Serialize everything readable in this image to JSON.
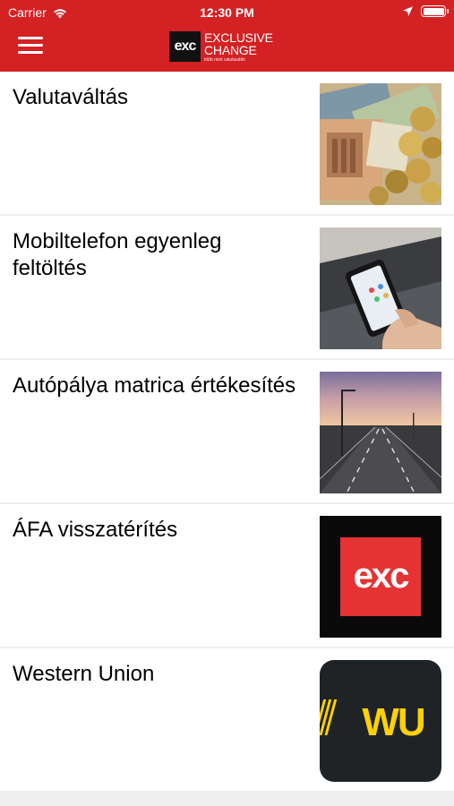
{
  "status_bar": {
    "carrier": "Carrier",
    "time": "12:30 PM"
  },
  "header": {
    "brand_mark": "exc",
    "brand_line1": "EXCLUSIVE",
    "brand_line2": "CHANGE",
    "brand_tagline": "több mint valutaváltó",
    "accent_color": "#d42124"
  },
  "services": [
    {
      "label": "Valutaváltás",
      "icon": "currency-photo"
    },
    {
      "label": "Mobiltelefon egyenleg feltöltés",
      "icon": "smartphone-photo"
    },
    {
      "label": "Autópálya matrica értékesítés",
      "icon": "highway-photo"
    },
    {
      "label": "ÁFA visszatérítés",
      "icon": "exc-logo"
    },
    {
      "label": "Western Union",
      "icon": "western-union-logo",
      "logo_text": "WU"
    }
  ]
}
